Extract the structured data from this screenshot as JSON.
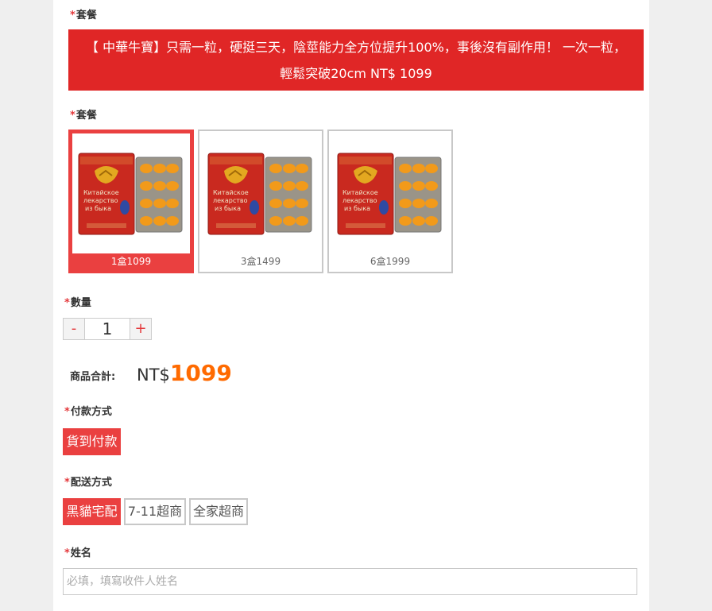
{
  "sections": {
    "package_title_1": "套餐",
    "package_title_2": "套餐",
    "quantity_title": "數量",
    "payment_title": "付款方式",
    "shipping_title": "配送方式",
    "name_title": "姓名",
    "required_mark": "*"
  },
  "banner": {
    "line1": "【 中華牛寶】只需一粒，硬挺三天，陰莖能力全方位提升100%，事後沒有副作用！ 一次一粒，",
    "line2": "輕鬆突破20cm NT$ 1099"
  },
  "packages": [
    {
      "label": "1盒1099",
      "selected": true
    },
    {
      "label": "3盒1499",
      "selected": false
    },
    {
      "label": "6盒1999",
      "selected": false
    }
  ],
  "product_box_text": {
    "l1": "Китайское",
    "l2": "лекарство",
    "l3": "из быка"
  },
  "quantity": {
    "minus": "-",
    "value": "1",
    "plus": "+"
  },
  "total": {
    "label": "商品合計:",
    "currency": "NT$",
    "amount": "1099"
  },
  "payment": {
    "options": [
      {
        "label": "貨到付款",
        "selected": true
      }
    ]
  },
  "shipping": {
    "options": [
      {
        "label": "黑貓宅配",
        "selected": true
      },
      {
        "label": "7-11超商",
        "selected": false
      },
      {
        "label": "全家超商",
        "selected": false
      }
    ]
  },
  "name": {
    "placeholder": "必填，填寫收件人姓名"
  },
  "colors": {
    "accent": "#ea4040",
    "banner": "#e02626",
    "price": "#ff6a00"
  }
}
